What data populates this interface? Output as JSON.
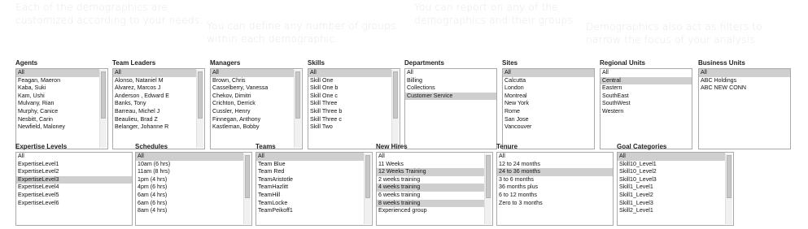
{
  "captions": [
    {
      "lines": [
        "Each of the demographics are",
        "customized according to your needs."
      ]
    },
    {
      "lines": [
        "You can define any number of groups",
        "within each demographic."
      ]
    },
    {
      "lines": [
        "You can report on any of the",
        "demographics and their groups."
      ]
    },
    {
      "lines": [
        "Demographics also act as filters to",
        "narrow the focus of your analysis."
      ]
    }
  ],
  "panels": {
    "agents": {
      "title": "Agents",
      "items": [
        "All",
        "Feagan, Maeron",
        "Kaba, Suki",
        "Kam, Ushi",
        "Mulvany, Rian",
        "Murphy, Canice",
        "Nesbitt, Carin",
        "Newfield, Maloney"
      ],
      "selected": [
        0
      ]
    },
    "team_leaders": {
      "title": "Team Leaders",
      "items": [
        "All",
        "Alonso, Nataniel M",
        "Álvarez, Marcos J",
        "Anderson , Edward E",
        "Banks, Tony",
        "Barreau, Michel J",
        "Beaulieu, Brad Z",
        "Belanger, Johanne R"
      ],
      "selected": [
        0
      ]
    },
    "managers": {
      "title": "Managers",
      "items": [
        "All",
        "Brown, Chris",
        "Casselberry, Vanessa",
        "Chekov, Dimitri",
        "Crichton, Derrick",
        "Cussler, Henry",
        "Finnegan, Anthony",
        "Kastleman, Bobby"
      ],
      "selected": [
        0
      ]
    },
    "skills": {
      "title": "Skills",
      "items": [
        "All",
        "Skill One",
        "Skill One b",
        "Skill One c",
        "Skill Three",
        "Skill Three b",
        "Skill Three c",
        "Skill Two"
      ],
      "selected": [
        0
      ]
    },
    "departments": {
      "title": "Departments",
      "items": [
        "All",
        "Billing",
        "Collections",
        "Customer Service"
      ],
      "selected": [
        3
      ]
    },
    "sites": {
      "title": "Sites",
      "items": [
        "All",
        "Calcutta",
        "London",
        "Montreal",
        "New York",
        "Rome",
        "San Jose",
        "Vancouver"
      ],
      "selected": [
        0
      ]
    },
    "regional_units": {
      "title": "Regional Units",
      "items": [
        "All",
        "Central",
        "Eastern",
        "SouthEast",
        "SouthWest",
        "Western"
      ],
      "selected": [
        1
      ]
    },
    "business_units": {
      "title": "Business Units",
      "items": [
        "All",
        "ABC Holdings",
        "ABC NEW CONN"
      ],
      "selected": [
        0
      ]
    },
    "expertise_levels": {
      "title": "Expertise Levels",
      "items": [
        "All",
        "ExpertiseLevel1",
        "ExpertiseLevel2",
        "ExpertiseLevel3",
        "ExpertiseLevel4",
        "ExpertiseLevel5",
        "ExpertiseLevel6"
      ],
      "selected": [
        3
      ]
    },
    "schedules": {
      "title": "Schedules",
      "items": [
        "All",
        "10am (6 hrs)",
        "11am (8 hrs)",
        "1pm (4 hrs)",
        "4pm (6 hrs)",
        "6am (4 hrs)",
        "6am (6 hrs)",
        "8am (4 hrs)"
      ],
      "selected": [
        0
      ]
    },
    "teams": {
      "title": "Teams",
      "items": [
        "All",
        "Team Blue",
        "Team Red",
        "TeamAristotle",
        "TeamHazlitt",
        "TeamHill",
        "TeamLocke",
        "TeamPeikoff1"
      ],
      "selected": [
        0
      ]
    },
    "new_hires": {
      "title": "New Hires",
      "items": [
        "All",
        "11 Weeks",
        "12 Weeks Training",
        "2 weeks training",
        "4 weeks training",
        "6 weeks training",
        "8 weeks training",
        "Experienced group"
      ],
      "selected": [
        2,
        4,
        6
      ]
    },
    "tenure": {
      "title": "Tenure",
      "items": [
        "All",
        "12 to 24 months",
        "24 to 36 months",
        "3 to 6 months",
        "36 months plus",
        "6 to 12 months",
        "Zero to 3 months"
      ],
      "selected": [
        2
      ]
    },
    "goal_categories": {
      "title": "Goal Categories",
      "items": [
        "All",
        "Skill10_Level1",
        "Skill10_Level2",
        "Skill10_Level3",
        "Skill1_Level1",
        "Skill1_Level2",
        "Skill1_Level3",
        "Skill2_Level1"
      ],
      "selected": [
        0
      ]
    }
  },
  "colors": {
    "selected_row": "#cfcfcf",
    "caption_text": "#e8e8e8",
    "border": "#a9a9a9"
  }
}
